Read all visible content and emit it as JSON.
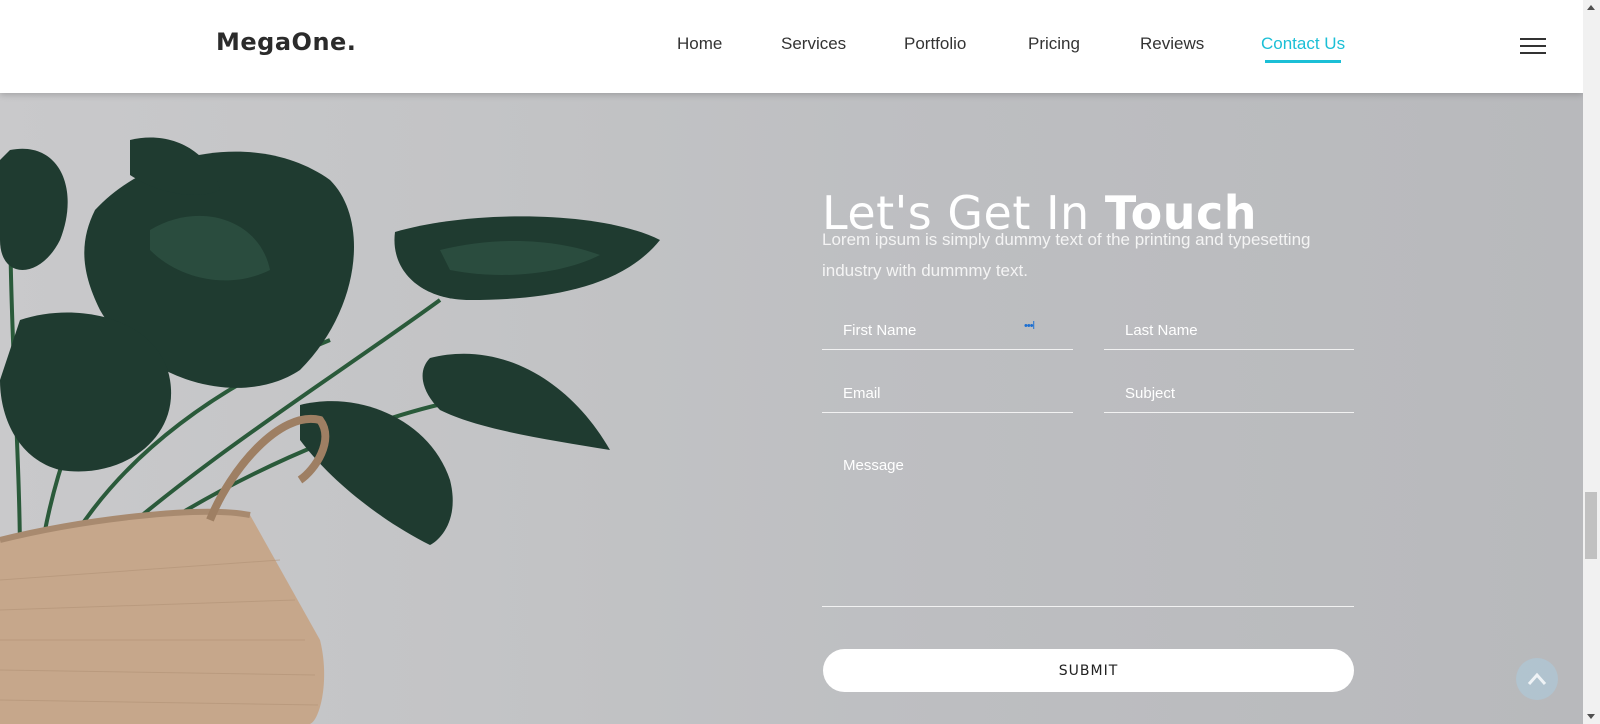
{
  "header": {
    "logo": "MegaOne.",
    "nav": [
      {
        "label": "Home",
        "active": false
      },
      {
        "label": "Services",
        "active": false
      },
      {
        "label": "Portfolio",
        "active": false
      },
      {
        "label": "Pricing",
        "active": false
      },
      {
        "label": "Reviews",
        "active": false
      },
      {
        "label": "Contact Us",
        "active": true
      }
    ],
    "menu_icon": "hamburger-icon"
  },
  "contact": {
    "title_light": "Let's Get In ",
    "title_bold": "Touch",
    "lead": "Lorem ipsum is simply dummy text of the printing and typesetting industry with dummmy text.",
    "fields": {
      "first_name": {
        "placeholder": "First Name",
        "value": ""
      },
      "last_name": {
        "placeholder": "Last Name",
        "value": ""
      },
      "email": {
        "placeholder": "Email",
        "value": ""
      },
      "subject": {
        "placeholder": "Subject",
        "value": ""
      },
      "message": {
        "placeholder": "Message",
        "value": ""
      }
    },
    "autofill_icon": "•••l",
    "submit_label": "SUBMIT"
  },
  "back_to_top_icon": "chevron-up-icon",
  "colors": {
    "accent": "#1bbfd6",
    "header_bg": "#ffffff",
    "text_dark": "#333333",
    "leaf": "#1f3b30",
    "basket": "#c6a78b"
  }
}
